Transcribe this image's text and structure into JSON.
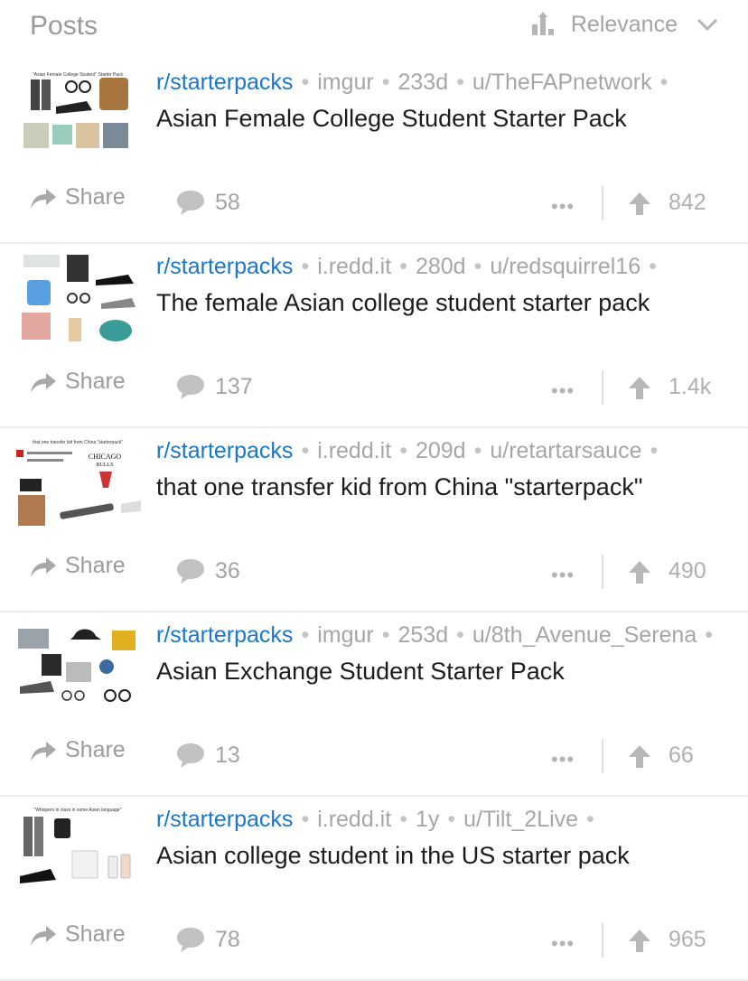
{
  "header": {
    "title": "Posts",
    "sort_label": "Relevance",
    "sort_icon": "bar-chart-up-icon",
    "dropdown_icon": "chevron-down-icon"
  },
  "colors": {
    "subreddit_link": "#1a77cf",
    "muted_text": "#a6a6a6",
    "divider": "#ececec"
  },
  "posts": [
    {
      "subreddit": "r/starterpacks",
      "domain": "imgur",
      "age": "233d",
      "author": "u/TheFAPnetwork",
      "title": "Asian Female College Student Starter Pack",
      "thumb_caption": "\"Asian Female College Student\" Starter Pack",
      "share_label": "Share",
      "comments": "58",
      "more_label": "•••",
      "votes": "842"
    },
    {
      "subreddit": "r/starterpacks",
      "domain": "i.redd.it",
      "age": "280d",
      "author": "u/redsquirrel16",
      "title": "The female Asian college student starter pack",
      "thumb_caption": "",
      "share_label": "Share",
      "comments": "137",
      "more_label": "•••",
      "votes": "1.4k"
    },
    {
      "subreddit": "r/starterpacks",
      "domain": "i.redd.it",
      "age": "209d",
      "author": "u/retartarsauce",
      "title": "that one transfer kid from China \"starterpack\"",
      "thumb_caption": "that one transfer kid from China \"starterpack\"",
      "share_label": "Share",
      "comments": "36",
      "more_label": "•••",
      "votes": "490"
    },
    {
      "subreddit": "r/starterpacks",
      "domain": "imgur",
      "age": "253d",
      "author": "u/8th_Avenue_Serena",
      "title": "Asian Exchange Student Starter Pack",
      "thumb_caption": "",
      "share_label": "Share",
      "comments": "13",
      "more_label": "•••",
      "votes": "66"
    },
    {
      "subreddit": "r/starterpacks",
      "domain": "i.redd.it",
      "age": "1y",
      "author": "u/Tilt_2Live",
      "title": "Asian college student in the US starter pack",
      "thumb_caption": "\"Whispers in class in some Asian language\"",
      "share_label": "Share",
      "comments": "78",
      "more_label": "•••",
      "votes": "965"
    }
  ]
}
